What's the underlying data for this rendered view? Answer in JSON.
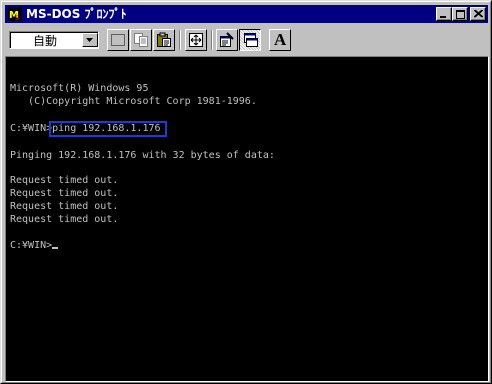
{
  "window": {
    "title": "MS-DOS ﾌﾟﾛﾝﾌﾟﾄ",
    "controls": [
      "minimize",
      "maximize",
      "close"
    ]
  },
  "toolbar": {
    "font_size_value": "自動",
    "buttons": [
      "mark-icon",
      "copy-icon",
      "paste-icon",
      "fullscreen-icon",
      "properties-icon",
      "background-icon",
      "font-icon"
    ],
    "font_button_label": "A"
  },
  "console": {
    "lines": [
      "Microsoft(R) Windows 95",
      "   (C)Copyright Microsoft Corp 1981-1996.",
      "C:¥WIN>ping 192.168.1.176",
      "Pinging 192.168.1.176 with 32 bytes of data:",
      "Request timed out.",
      "Request timed out.",
      "Request timed out.",
      "Request timed out.",
      "C:¥WIN>"
    ],
    "highlighted_command": "ping 192.168.1.176",
    "text_color": "#c0c0c0",
    "background_color": "#000000",
    "highlight_color": "#1a3bd8"
  }
}
